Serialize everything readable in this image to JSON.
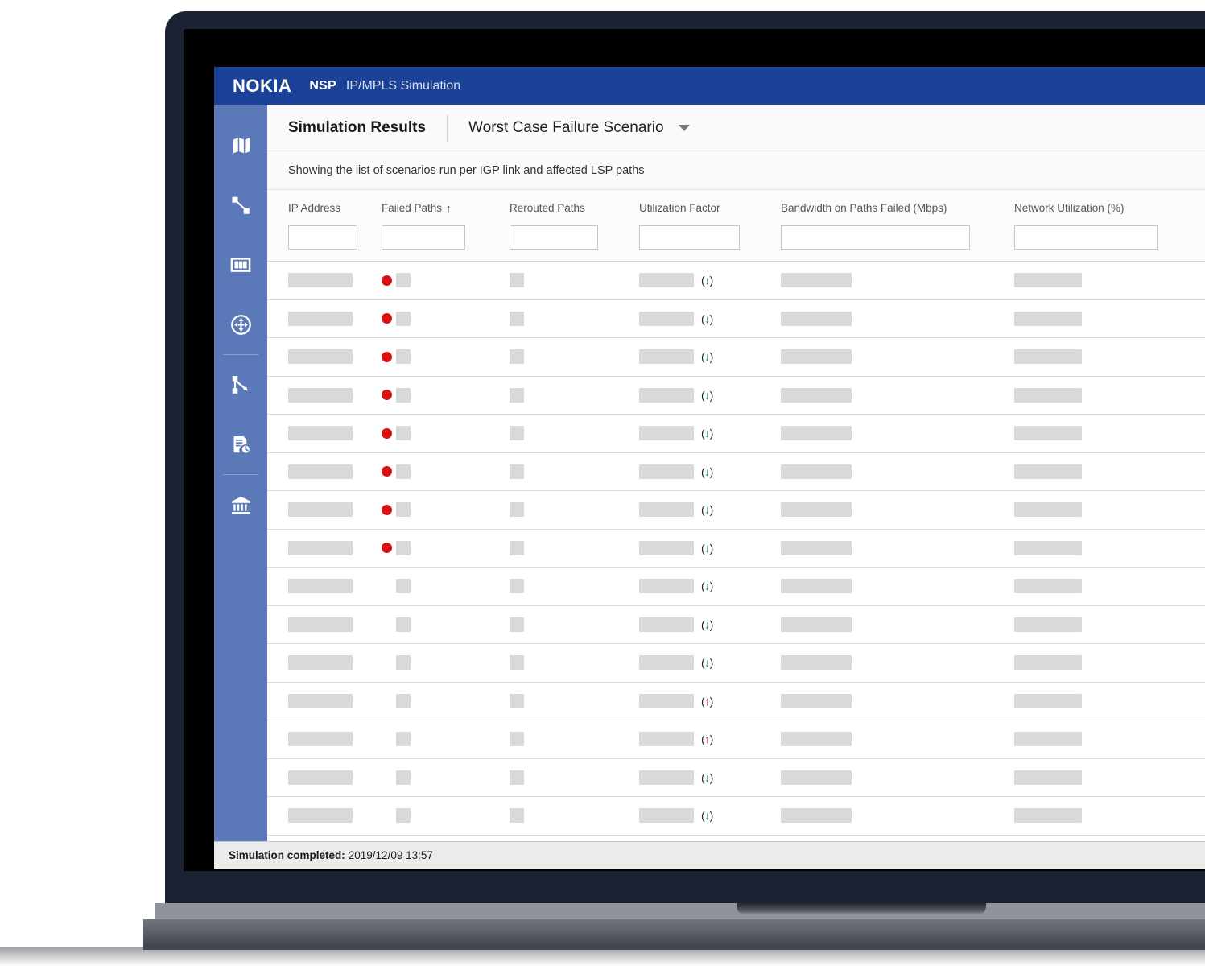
{
  "topbar": {
    "brand": "NOKIA",
    "product": "NSP",
    "subtitle": "IP/MPLS Simulation"
  },
  "sidebar": {
    "items": [
      {
        "icon": "map-icon",
        "name": "sidebar-item-map"
      },
      {
        "icon": "link-path-icon",
        "name": "sidebar-item-links"
      },
      {
        "icon": "columns-icon",
        "name": "sidebar-item-columns"
      },
      {
        "icon": "move-icon",
        "name": "sidebar-item-move"
      },
      {
        "icon": "path-split-icon",
        "name": "sidebar-item-path-split"
      },
      {
        "icon": "document-history-icon",
        "name": "sidebar-item-reports"
      },
      {
        "icon": "bank-icon",
        "name": "sidebar-item-inventory"
      }
    ]
  },
  "toolbar": {
    "title": "Simulation Results",
    "scenario_selected": "Worst Case Failure Scenario",
    "chevron": "chevron-down-icon"
  },
  "subheader": {
    "text": "Showing the list of scenarios run per IGP link and affected LSP paths"
  },
  "table": {
    "columns": [
      {
        "label": "IP Address",
        "key": "ip",
        "sort": ""
      },
      {
        "label": "Failed Paths",
        "key": "fail",
        "sort": "↑"
      },
      {
        "label": "Rerouted Paths",
        "key": "rer",
        "sort": ""
      },
      {
        "label": "Utilization Factor",
        "key": "util",
        "sort": ""
      },
      {
        "label": "Bandwidth on Paths Failed (Mbps)",
        "key": "bw",
        "sort": ""
      },
      {
        "label": "Network Utilization (%)",
        "key": "net",
        "sort": ""
      }
    ],
    "filters": {
      "ip": "",
      "fail": "",
      "rer": "",
      "util": "",
      "bw": "",
      "net": ""
    },
    "rows": [
      {
        "failed_alert": true,
        "trend": "down",
        "trend_text": "(↓)"
      },
      {
        "failed_alert": true,
        "trend": "down",
        "trend_text": "(↓)"
      },
      {
        "failed_alert": true,
        "trend": "down",
        "trend_text": "(↓)"
      },
      {
        "failed_alert": true,
        "trend": "down",
        "trend_text": "(↓)"
      },
      {
        "failed_alert": true,
        "trend": "down",
        "trend_text": "(↓)"
      },
      {
        "failed_alert": true,
        "trend": "down",
        "trend_text": "(↓)"
      },
      {
        "failed_alert": true,
        "trend": "down",
        "trend_text": "(↓)"
      },
      {
        "failed_alert": true,
        "trend": "down",
        "trend_text": "(↓)"
      },
      {
        "failed_alert": false,
        "trend": "down",
        "trend_text": "(↓)"
      },
      {
        "failed_alert": false,
        "trend": "down",
        "trend_text": "(↓)"
      },
      {
        "failed_alert": false,
        "trend": "down",
        "trend_text": "(↓)"
      },
      {
        "failed_alert": false,
        "trend": "up",
        "trend_text": "(↑)"
      },
      {
        "failed_alert": false,
        "trend": "up",
        "trend_text": "(↑)"
      },
      {
        "failed_alert": false,
        "trend": "down",
        "trend_text": "(↓)"
      },
      {
        "failed_alert": false,
        "trend": "down",
        "trend_text": "(↓)"
      }
    ]
  },
  "statusbar": {
    "label": "Simulation completed:",
    "timestamp": "2019/12/09 13:57"
  },
  "colors": {
    "header_blue": "#1b4298",
    "sidebar_blue": "#5b79b8",
    "alert_red": "#d81212",
    "trend_down_green": "#1c8f2e",
    "trend_up_red": "#e01b1b",
    "placeholder_gray": "#d9d9d9"
  }
}
